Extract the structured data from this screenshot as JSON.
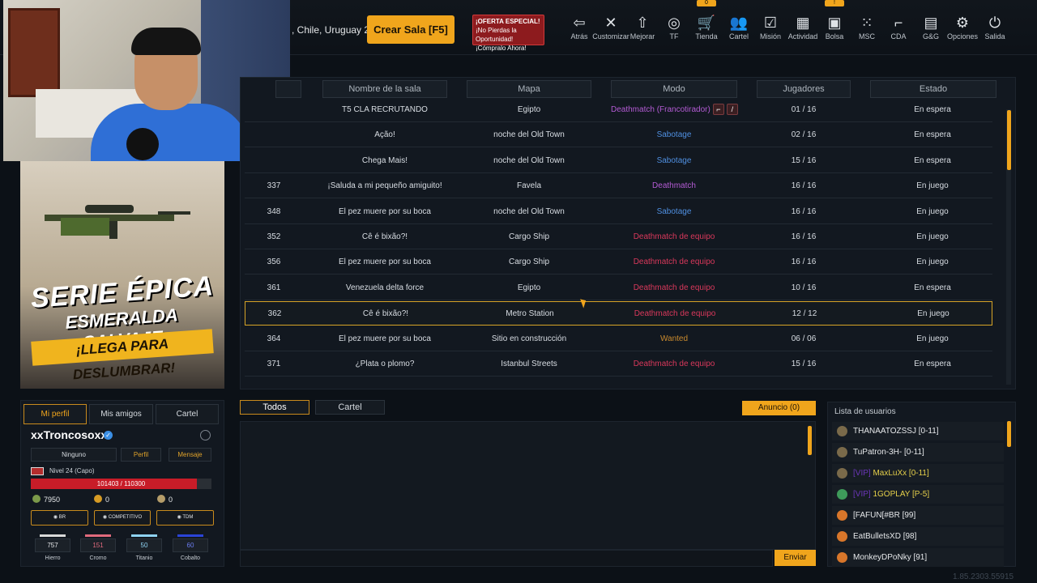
{
  "topbar": {
    "server_text": ", Chile, Uruguay 2",
    "create_room_label": "Crear Sala [F5]",
    "offer_lines": [
      "¡OFERTA ESPECIAL!",
      "¡No Pierdas la Oportunidad!",
      "¡Cómpralo Ahora!"
    ],
    "nav": [
      {
        "label": "Atrás",
        "icon": "back-icon",
        "glyph": "⇦"
      },
      {
        "label": "Customizar",
        "icon": "tools-icon",
        "glyph": "✕"
      },
      {
        "label": "Mejorar",
        "icon": "upgrade-icon",
        "glyph": "⇧"
      },
      {
        "label": "TF",
        "icon": "coins-icon",
        "glyph": "◎"
      },
      {
        "label": "Tienda",
        "icon": "cart-icon",
        "glyph": "🛒",
        "badge": "0"
      },
      {
        "label": "Cartel",
        "icon": "group-icon",
        "glyph": "👥"
      },
      {
        "label": "Misión",
        "icon": "clipboard-icon",
        "glyph": "☑"
      },
      {
        "label": "Actividad",
        "icon": "calendar-icon",
        "glyph": "▦"
      },
      {
        "label": "Bolsa",
        "icon": "bag-icon",
        "glyph": "▣",
        "badge": "!"
      },
      {
        "label": "MSC",
        "icon": "dots-icon",
        "glyph": "⁙"
      },
      {
        "label": "CDA",
        "icon": "gun-icon",
        "glyph": "⌐"
      },
      {
        "label": "G&G",
        "icon": "card-icon",
        "glyph": "▤"
      },
      {
        "label": "Opciones",
        "icon": "gear-icon",
        "glyph": "⚙"
      },
      {
        "label": "Salida",
        "icon": "power-icon",
        "glyph": "⏻"
      }
    ]
  },
  "banner": {
    "line1": "SERIE ÉPICA",
    "line2": "ESMERALDA SALVAJE",
    "line3": "¡LLEGA PARA DESLUMBRAR!"
  },
  "rooms": {
    "headers": [
      "Nombre de la sala",
      "Mapa",
      "Modo",
      "Jugadores",
      "Estado"
    ],
    "rows": [
      {
        "num": "",
        "name": "T5 CLA RECRUTANDO",
        "map": "Egipto",
        "mode": "Deathmatch (Francotirador)",
        "mode_class": "m-purple",
        "players": "01 / 16",
        "status": "En espera",
        "icons": true
      },
      {
        "num": "",
        "name": "Ação!",
        "map": "noche del Old Town",
        "mode": "Sabotage",
        "mode_class": "m-blue",
        "players": "02 / 16",
        "status": "En espera"
      },
      {
        "num": "",
        "name": "Chega Mais!",
        "map": "noche del Old Town",
        "mode": "Sabotage",
        "mode_class": "m-blue",
        "players": "15 / 16",
        "status": "En espera"
      },
      {
        "num": "337",
        "name": "¡Saluda a mi pequeño amiguito!",
        "map": "Favela",
        "mode": "Deathmatch",
        "mode_class": "m-purple",
        "players": "16 / 16",
        "status": "En juego"
      },
      {
        "num": "348",
        "name": "El pez muere por su boca",
        "map": "noche del Old Town",
        "mode": "Sabotage",
        "mode_class": "m-blue",
        "players": "16 / 16",
        "status": "En juego"
      },
      {
        "num": "352",
        "name": "Cê é bixão?!",
        "map": "Cargo Ship",
        "mode": "Deathmatch de equipo",
        "mode_class": "m-red",
        "players": "16 / 16",
        "status": "En juego"
      },
      {
        "num": "356",
        "name": "El pez muere por su boca",
        "map": "Cargo Ship",
        "mode": "Deathmatch de equipo",
        "mode_class": "m-red",
        "players": "16 / 16",
        "status": "En juego"
      },
      {
        "num": "361",
        "name": "Venezuela delta force",
        "map": "Egipto",
        "mode": "Deathmatch de equipo",
        "mode_class": "m-red",
        "players": "10 / 16",
        "status": "En espera"
      },
      {
        "num": "362",
        "name": "Cê é bixão?!",
        "map": "Metro Station",
        "mode": "Deathmatch de equipo",
        "mode_class": "m-red",
        "players": "12 / 12",
        "status": "En juego",
        "selected": true
      },
      {
        "num": "364",
        "name": "El pez muere por su boca",
        "map": "Sitio en construcción",
        "mode": "Wanted",
        "mode_class": "m-gold",
        "players": "06 / 06",
        "status": "En juego"
      },
      {
        "num": "371",
        "name": "¿Plata o plomo?",
        "map": "Istanbul Streets",
        "mode": "Deathmatch de equipo",
        "mode_class": "m-red",
        "players": "15 / 16",
        "status": "En espera"
      }
    ]
  },
  "profile": {
    "tabs": [
      "Mi perfil",
      "Mis amigos",
      "Cartel"
    ],
    "name": "xxTroncosoxx",
    "buttons": [
      "Ninguno",
      "Perfil",
      "Mensaje"
    ],
    "level": "Nivel 24 (Capo)",
    "xp_text": "101403 / 110300",
    "xp_progress": 0.919,
    "currencies": [
      {
        "value": "7950",
        "color": "#7c9a4a"
      },
      {
        "value": "0",
        "color": "#d79b24"
      },
      {
        "value": "0",
        "color": "#b59d6a"
      }
    ],
    "modes": [
      "BR",
      "COMPETITIVO",
      "TDM"
    ],
    "materials": [
      {
        "name": "Hierro",
        "value": "757",
        "color": "#d9d9d9",
        "text_color": "#e8eaec"
      },
      {
        "name": "Cromo",
        "value": "151",
        "color": "#e06a7c",
        "text_color": "#e06a7c"
      },
      {
        "name": "Titanio",
        "value": "50",
        "color": "#8fd3f2",
        "text_color": "#8fd3f2"
      },
      {
        "name": "Cobalto",
        "value": "60",
        "color": "#2a44d8",
        "text_color": "#6b7cf0"
      }
    ]
  },
  "chat": {
    "tabs": [
      "Todos",
      "Cartel"
    ],
    "announce_label": "Anuncio (0)",
    "send_label": "Enviar"
  },
  "users": {
    "title": "Lista de usuarios",
    "list": [
      {
        "prefix": "",
        "name": "THANAATOZSSJ [0-11]",
        "name_color": "#e6e8ea",
        "rank_color": "#7a6a4a"
      },
      {
        "prefix": "",
        "name": "TuPatron-3H- [0-11]",
        "name_color": "#e6e8ea",
        "rank_color": "#7a6a4a"
      },
      {
        "prefix": "[VIP]",
        "name": " MaxLuXx [0-11]",
        "name_color": "#e6d04a",
        "rank_color": "#7a6a4a"
      },
      {
        "prefix": "[VIP]",
        "name": " 1GOPLAY [P-5]",
        "name_color": "#e6d04a",
        "rank_color": "#3e9a5a"
      },
      {
        "prefix": "",
        "name": "[FAFUN[#BR [99]",
        "name_color": "#e6e8ea",
        "rank_color": "#d8762a"
      },
      {
        "prefix": "",
        "name": "EatBulletsXD [98]",
        "name_color": "#e6e8ea",
        "rank_color": "#d8762a"
      },
      {
        "prefix": "",
        "name": "MonkeyDPoNky [91]",
        "name_color": "#e6e8ea",
        "rank_color": "#d8762a"
      }
    ]
  },
  "version": "1.85.2303.55915"
}
